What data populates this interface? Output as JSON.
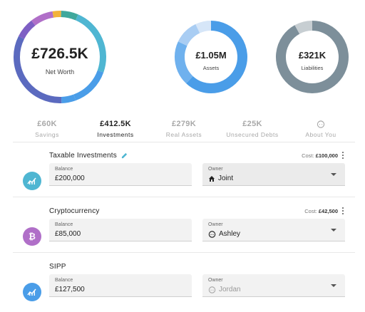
{
  "summary": {
    "net_worth": {
      "value": "£726.5K",
      "label": "Net Worth",
      "color_track": "#eeeeee"
    },
    "assets": {
      "value": "£1.05M",
      "label": "Assets"
    },
    "liabilities": {
      "value": "£321K",
      "label": "Liabilities"
    }
  },
  "tabs": [
    {
      "value": "£60K",
      "label": "Savings",
      "active": false
    },
    {
      "value": "£412.5K",
      "label": "Investments",
      "active": true
    },
    {
      "value": "£279K",
      "label": "Real Assets",
      "active": false
    },
    {
      "value": "£25K",
      "label": "Unsecured Debts",
      "active": false
    },
    {
      "value": "",
      "label": "About You",
      "active": false,
      "icon": "about-you-icon"
    }
  ],
  "accounts": [
    {
      "title": "Taxable Investments",
      "title_icon": "edit-pencil-icon",
      "cost_label": "Cost:",
      "cost_value": "£100,000",
      "avatar_icon": "investment-chart-icon",
      "avatar_color": "#4fb6d2",
      "balance_label": "Balance",
      "balance_value": "£200,000",
      "owner_label": "Owner",
      "owner_value": "Joint",
      "owner_icon": "home-icon"
    },
    {
      "title": "Cryptocurrency",
      "cost_label": "Cost:",
      "cost_value": "£42,500",
      "avatar_icon": "bitcoin-icon",
      "avatar_color": "#b06fc8",
      "balance_label": "Balance",
      "balance_value": "£85,000",
      "owner_label": "Owner",
      "owner_value": "Ashley",
      "owner_icon": "person-face-icon"
    },
    {
      "title": "SIPP",
      "avatar_icon": "investment-chart-icon",
      "avatar_color": "#4a9de8",
      "balance_label": "Balance",
      "balance_value": "£127,500",
      "owner_label": "Owner",
      "owner_value": "Jordan",
      "owner_icon": "person-face-icon"
    }
  ],
  "chart_data": [
    {
      "type": "pie",
      "subtype": "donut",
      "title": "",
      "center_value": "£726.5K",
      "center_label": "Net Worth",
      "segments": [
        {
          "value": 5,
          "color": "#4a9de8"
        },
        {
          "value": 33,
          "color": "#5b6abf"
        },
        {
          "value": 7,
          "color": "#7e5fc4"
        },
        {
          "value": 8,
          "color": "#b06fc8"
        },
        {
          "value": 3,
          "color": "#f2b23a"
        },
        {
          "value": 6,
          "color": "#3fa89c"
        },
        {
          "value": 24,
          "color": "#4fb6d2"
        },
        {
          "value": 14,
          "color": "#4a9de8"
        }
      ],
      "start_angle_deg": 160
    },
    {
      "type": "pie",
      "subtype": "donut",
      "title": "",
      "center_value": "£1.05M",
      "center_label": "Assets",
      "segments": [
        {
          "value": 62,
          "color": "#4a9de8"
        },
        {
          "value": 20,
          "color": "#6fb1ee"
        },
        {
          "value": 11,
          "color": "#a9cdf3"
        },
        {
          "value": 7,
          "color": "#d6e6f8"
        }
      ],
      "start_angle_deg": 0
    },
    {
      "type": "pie",
      "subtype": "donut",
      "title": "",
      "center_value": "£321K",
      "center_label": "Liabilities",
      "segments": [
        {
          "value": 92,
          "color": "#7d8f9a"
        },
        {
          "value": 8,
          "color": "#c7ced2"
        }
      ],
      "start_angle_deg": 0
    }
  ]
}
